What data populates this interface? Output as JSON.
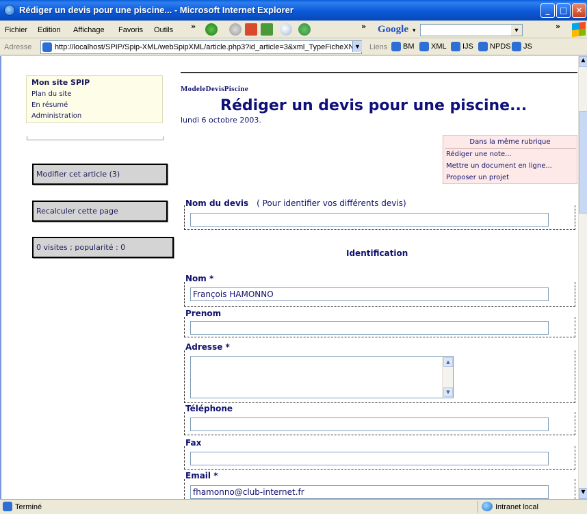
{
  "window": {
    "title": "Rédiger un devis pour une piscine... - Microsoft Internet Explorer"
  },
  "menu": [
    "Fichier",
    "Edition",
    "Affichage",
    "Favoris",
    "Outils"
  ],
  "search": {
    "brand": "Google",
    "value": ""
  },
  "address": {
    "label": "Adresse",
    "url": "http://localhost/SPIP/Spip-XML/webSpipXML/article.php3?id_article=3&xml_TypeFicheXN"
  },
  "links": {
    "label": "Liens",
    "items": [
      "BM",
      "XML",
      "IJS",
      "NPDS",
      "JS"
    ]
  },
  "sidebar": {
    "site_name": "Mon site SPIP",
    "nav": [
      "Plan du site",
      "En résumé",
      "Administration"
    ],
    "modify_button": "Modifier cet article (3)",
    "recalc_button": "Recalculer cette page",
    "stats": "0 visites ; popularité : 0"
  },
  "article": {
    "breadcrumb": "ModeleDevisPiscine",
    "title": "Rédiger un devis pour une piscine...",
    "date": "lundi 6 octobre 2003."
  },
  "related": {
    "heading": "Dans la même rubrique",
    "items": [
      "Rédiger une note...",
      "Mettre un document en ligne...",
      "Proposer un projet"
    ]
  },
  "form": {
    "devis_label": "Nom du devis",
    "devis_hint": "( Pour identifier vos différents devis)",
    "devis_value": "",
    "section_title": "Identification",
    "nom_label": "Nom *",
    "nom_value": "François HAMONNO",
    "prenom_label": "Prenom",
    "prenom_value": "",
    "adresse_label": "Adresse *",
    "adresse_value": "",
    "telephone_label": "Téléphone",
    "telephone_value": "",
    "fax_label": "Fax",
    "fax_value": "",
    "email_label": "Email *",
    "email_value": "fhamonno@club-internet.fr"
  },
  "status": {
    "text": "Terminé",
    "zone": "Intranet local"
  },
  "colors": {
    "accent": "#10106e",
    "titlebar": "#0b59d8",
    "related_bg": "#fde9e7"
  },
  "icons": [
    "ie-logo-icon",
    "back-icon",
    "forward-icon",
    "stop-icon",
    "refresh-icon",
    "search-icon",
    "history-icon",
    "page-icon",
    "globe-icon"
  ]
}
